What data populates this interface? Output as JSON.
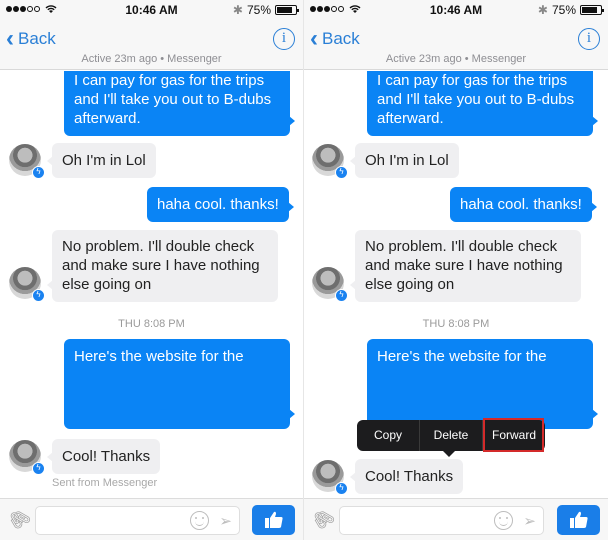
{
  "status_bar": {
    "time": "10:46 AM",
    "battery_percent_label": "75%",
    "battery_level": 0.75,
    "signal_bars_filled": 3,
    "signal_bars_total": 5
  },
  "header": {
    "back_label": "Back",
    "subtitle": "Active 23m ago • Messenger",
    "info_label": "i"
  },
  "colors": {
    "outgoing_bubble": "#0a84f5",
    "incoming_bubble": "#efeff1",
    "accent": "#2a7fd6",
    "highlight_box": "#d42a2a"
  },
  "left": {
    "messages": [
      {
        "dir": "out",
        "text": "I can pay for gas for the trips and I'll take you out to B-dubs afterward."
      },
      {
        "dir": "in",
        "text": "Oh I'm in Lol"
      },
      {
        "dir": "out",
        "text": "haha cool. thanks!"
      },
      {
        "dir": "in",
        "text": "No problem. I'll double check and make sure I have nothing else going on"
      },
      {
        "dir": "out",
        "text": "Here's the website for the"
      },
      {
        "dir": "in",
        "text": "Cool! Thanks"
      }
    ],
    "timestamp": "THU 8:08 PM",
    "sent_from": "Sent from Messenger"
  },
  "right": {
    "messages": [
      {
        "dir": "out",
        "text": "I can pay for gas for the trips and I'll take you out to B-dubs afterward."
      },
      {
        "dir": "in",
        "text": "Oh I'm in Lol"
      },
      {
        "dir": "out",
        "text": "haha cool. thanks!"
      },
      {
        "dir": "in",
        "text": "No problem. I'll double check and make sure I have nothing else going on"
      },
      {
        "dir": "out",
        "text": "Here's the website for the"
      },
      {
        "dir": "in",
        "text": "Cool! Thanks"
      }
    ],
    "timestamp": "THU 8:08 PM",
    "context_menu": {
      "items": [
        "Copy",
        "Delete",
        "Forward"
      ],
      "highlighted": "Forward"
    }
  },
  "composer": {
    "placeholder": ""
  }
}
